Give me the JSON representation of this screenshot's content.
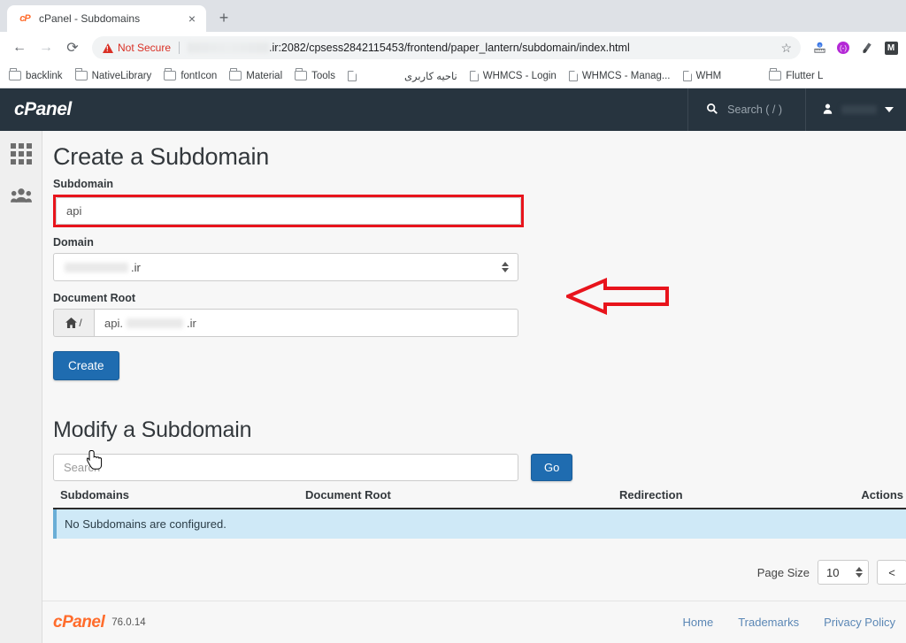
{
  "browser": {
    "tab": {
      "favicon": "cpanel-favicon",
      "title": "cPanel - Subdomains",
      "close_label": "×"
    },
    "new_tab_label": "+",
    "nav": {
      "back": "←",
      "forward": "→",
      "reload": "⟳"
    },
    "omnibox": {
      "security_label": "Not Secure",
      "url_visible": ".ir:2082/cpsess2842115453/frontend/paper_lantern/subdomain/index.html",
      "star_icon": "☆"
    },
    "extensions": [
      {
        "name": "ruler-extension-icon",
        "glyph": "⚖"
      },
      {
        "name": "purple-circle-extension-icon",
        "glyph": "●"
      },
      {
        "name": "eyedropper-extension-icon",
        "glyph": "✒"
      },
      {
        "name": "m-extension-icon",
        "glyph": "M"
      }
    ],
    "bookmarks": [
      {
        "label": "backlink",
        "type": "folder"
      },
      {
        "label": "NativeLibrary",
        "type": "folder"
      },
      {
        "label": "fontIcon",
        "type": "folder"
      },
      {
        "label": "Material",
        "type": "folder"
      },
      {
        "label": "Tools",
        "type": "folder"
      },
      {
        "label": "",
        "type": "doc"
      },
      {
        "label": "ناحیه کاربری",
        "type": "doc"
      },
      {
        "label": "WHMCS - Login",
        "type": "doc"
      },
      {
        "label": "WHMCS - Manag...",
        "type": "doc"
      },
      {
        "label": "WHM",
        "type": "doc"
      },
      {
        "label": "Flutter L",
        "type": "folder"
      }
    ]
  },
  "cpanel": {
    "header": {
      "logo": "cPanel",
      "search_placeholder": "Search ( / )",
      "search_icon": "🔍",
      "user_icon": "👤"
    },
    "sidebar": {
      "items": [
        {
          "name": "apps-grid",
          "label": ""
        },
        {
          "name": "user-manager",
          "label": ""
        }
      ]
    },
    "create_section": {
      "title": "Create a Subdomain",
      "subdomain_label": "Subdomain",
      "subdomain_value": "api",
      "domain_label": "Domain",
      "domain_value": ".ir",
      "docroot_label": "Document Root",
      "docroot_prefix": "/",
      "docroot_value_start": "api.",
      "docroot_value_end": ".ir",
      "home_icon": "🏠",
      "create_button": "Create"
    },
    "modify_section": {
      "title": "Modify a Subdomain",
      "search_placeholder": "Search",
      "go_button": "Go",
      "columns": [
        "Subdomains",
        "Document Root",
        "Redirection",
        "Actions"
      ],
      "empty_message": "No Subdomains are configured.",
      "rows": []
    },
    "pagination": {
      "page_size_label": "Page Size",
      "page_size_value": "10",
      "prev_label": "<"
    },
    "footer": {
      "logo": "cPanel",
      "version": "76.0.14",
      "links": [
        "Home",
        "Trademarks",
        "Privacy Policy"
      ]
    }
  },
  "annotations": {
    "arrow": {
      "name": "red-left-arrow",
      "color": "#e8141c"
    },
    "highlight": {
      "name": "red-highlight-box",
      "color": "#e8141c"
    }
  }
}
